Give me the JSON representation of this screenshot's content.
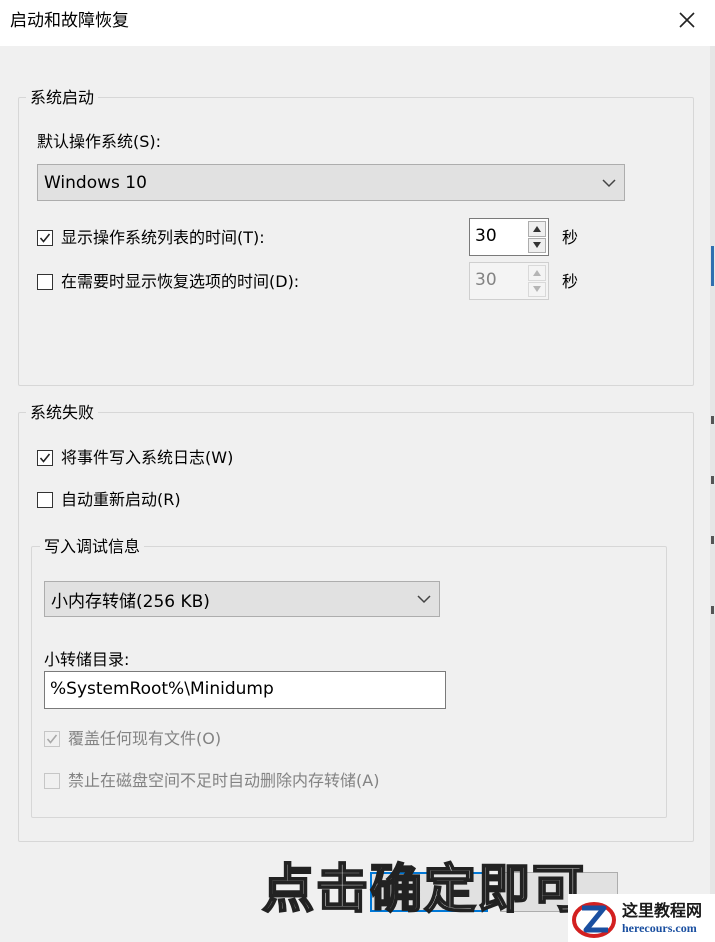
{
  "window": {
    "title": "启动和故障恢复",
    "close_icon": "close-icon"
  },
  "system_startup": {
    "legend": "系统启动",
    "default_os_label": "默认操作系统(S):",
    "default_os_value": "Windows 10",
    "show_os_list": {
      "checked": true,
      "label": "显示操作系统列表的时间(T):",
      "value": "30",
      "unit": "秒"
    },
    "show_recovery": {
      "checked": false,
      "label": "在需要时显示恢复选项的时间(D):",
      "value": "30",
      "unit": "秒",
      "disabled": true
    }
  },
  "system_failure": {
    "legend": "系统失败",
    "write_event": {
      "checked": true,
      "label": "将事件写入系统日志(W)"
    },
    "auto_restart": {
      "checked": false,
      "label": "自动重新启动(R)"
    },
    "debug_info": {
      "legend": "写入调试信息",
      "dump_type_value": "小内存转储(256 KB)",
      "dump_dir_label": "小转储目录:",
      "dump_dir_value": "%SystemRoot%\\Minidump",
      "overwrite": {
        "checked": true,
        "disabled": true,
        "label": "覆盖任何现有文件(O)"
      },
      "disable_auto_delete": {
        "checked": false,
        "disabled": true,
        "label": "禁止在磁盘空间不足时自动删除内存转储(A)"
      }
    }
  },
  "overlay": {
    "caption": "点击确定即可",
    "watermark_cn": "这里教程网",
    "watermark_en": "herecours.com"
  },
  "colors": {
    "focus_blue": "#0078d7",
    "window_bg": "#f0f0f0"
  }
}
